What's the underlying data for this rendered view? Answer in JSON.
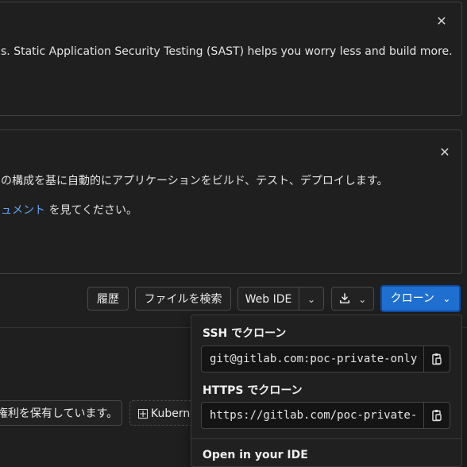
{
  "sast_banner": {
    "text": "s. Static Application Security Testing (SAST) helps you worry less and build more."
  },
  "autodevops_banner": {
    "text": "の構成を基に自動的にアプリケーションをビルド、テスト、デプロイします。",
    "link_text": "ュメント",
    "after_link": " を見てください。"
  },
  "toolbar": {
    "history_label": "履歴",
    "find_file_label": "ファイルを検索",
    "web_ide_label": "Web IDE",
    "clone_label": "クローン"
  },
  "footer": {
    "copyright_text": "権利を保有しています。",
    "kubernetes_label": "Kubern"
  },
  "clone_dropdown": {
    "ssh_label": "SSH でクローン",
    "ssh_value": "git@gitlab.com:poc-private-only",
    "https_label": "HTTPS でクローン",
    "https_value": "https://gitlab.com/poc-private-",
    "ide_label": "Open in your IDE"
  },
  "colors": {
    "accent": "#1f6fd1",
    "link": "#63a6f5",
    "background": "#1f1f1f"
  },
  "icons": {
    "close": "close-icon",
    "chevron": "chevron-down-icon",
    "download": "download-icon",
    "copy": "clipboard-icon",
    "plus": "plus-square-icon"
  }
}
